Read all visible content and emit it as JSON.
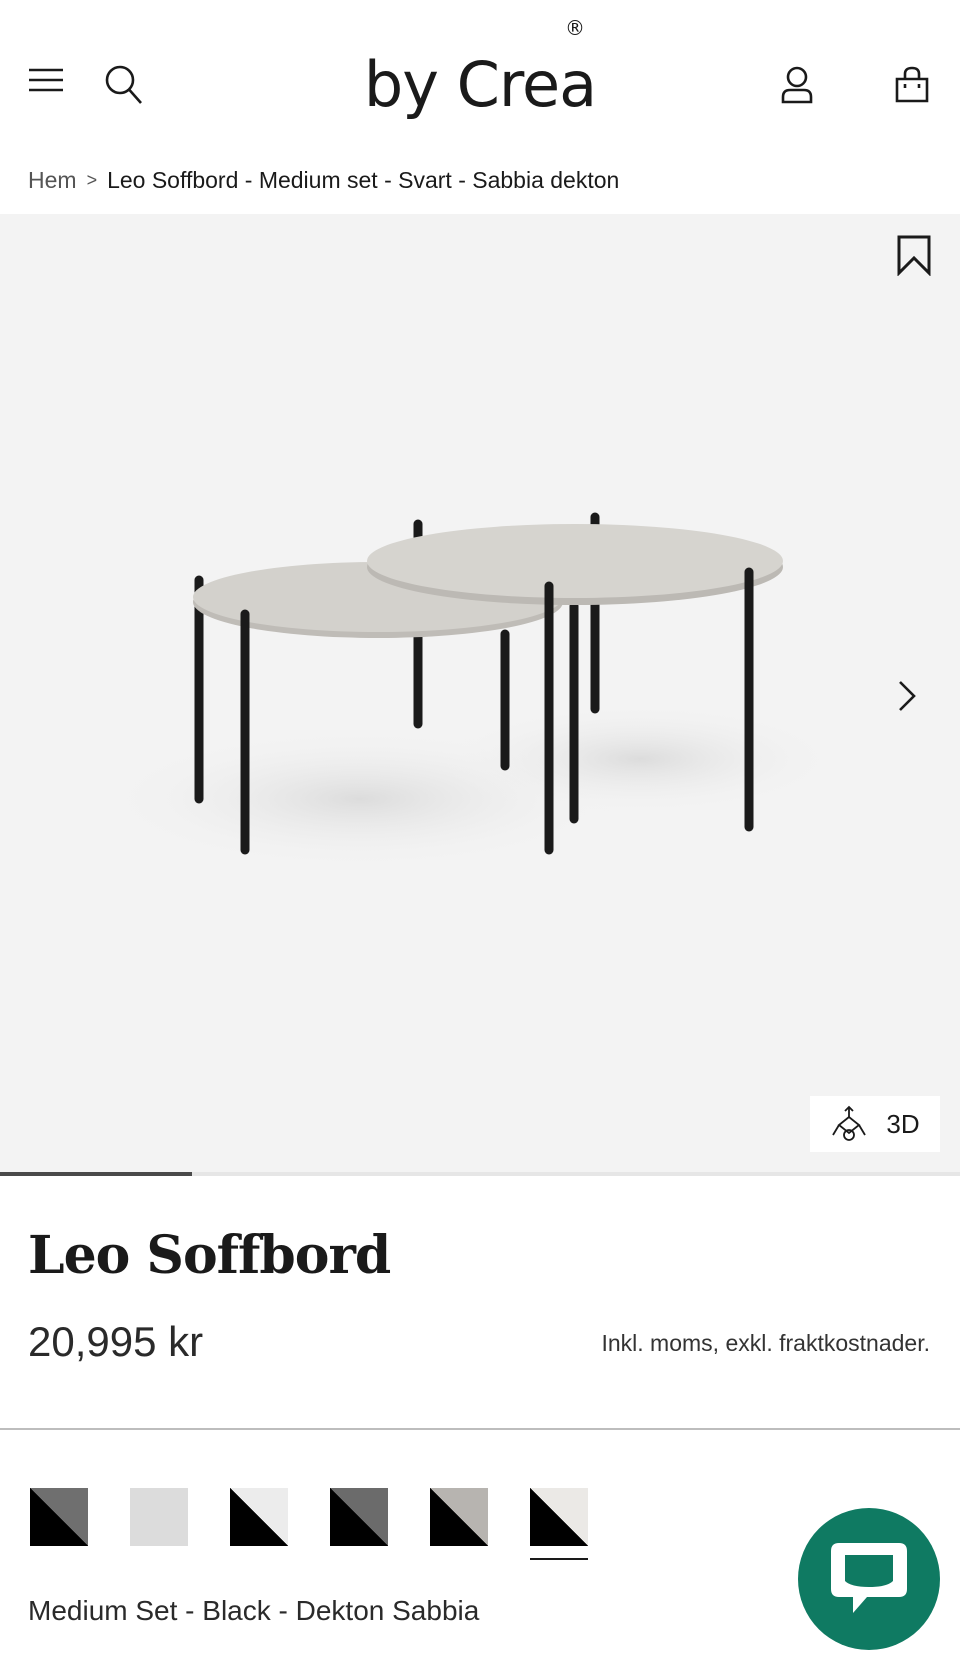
{
  "header": {
    "logo_text": "by Crea",
    "logo_mark": "®",
    "icons": [
      "menu-icon",
      "search-icon",
      "account-icon",
      "cart-icon"
    ]
  },
  "breadcrumb": {
    "home": "Hem",
    "separator": ">",
    "current": "Leo Soffbord - Medium set - Svart - Sabbia dekton"
  },
  "gallery": {
    "button_3d_label": "3D",
    "progress_fraction": 0.2
  },
  "product": {
    "title": "Leo Soffbord",
    "price": "20,995 kr",
    "tax_note": "Inkl. moms, exkl. fraktkostnader.",
    "swatches": [
      {
        "name": "black-grey",
        "tl": "#6f6f6f",
        "br": "#000000"
      },
      {
        "name": "light-grey",
        "tl": "#dcdcdc",
        "br": "#dcdcdc"
      },
      {
        "name": "black-white",
        "tl": "#ececec",
        "br": "#000000"
      },
      {
        "name": "black-darkgrey",
        "tl": "#6b6b6b",
        "br": "#000000"
      },
      {
        "name": "black-stone",
        "tl": "#b7b4b0",
        "br": "#000000"
      },
      {
        "name": "black-sabbia",
        "tl": "#ebe9e6",
        "br": "#000000"
      }
    ],
    "selected_swatch_index": 5,
    "variant_label": "Medium Set - Black - Dekton Sabbia"
  },
  "colors": {
    "chat_accent": "#0f7a62",
    "gallery_bg": "#f3f3f3"
  }
}
